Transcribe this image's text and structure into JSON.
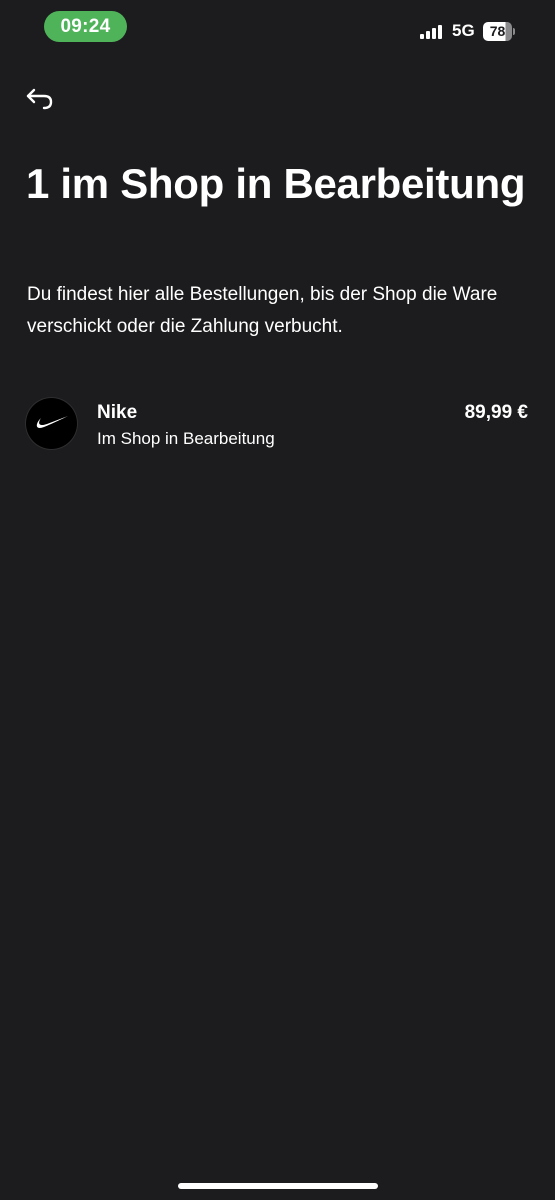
{
  "status_bar": {
    "time": "09:24",
    "network": "5G",
    "battery_level": "78",
    "battery_fraction": 0.78,
    "signal_icon": "cellular-signal-icon",
    "battery_icon": "battery-icon"
  },
  "header": {
    "back_icon": "back-arrow-icon",
    "title": "1 im Shop in Bearbeitung",
    "description": "Du findest hier alle Bestellungen, bis der Shop die Ware verschickt oder die Zahlung verbucht."
  },
  "orders": [
    {
      "merchant": "Nike",
      "status": "Im Shop in Bearbeitung",
      "amount": "89,99 €",
      "logo_icon": "nike-swoosh-logo"
    }
  ],
  "colors": {
    "background": "#1c1c1e",
    "text": "#ffffff",
    "time_pill": "#4fb35a"
  }
}
